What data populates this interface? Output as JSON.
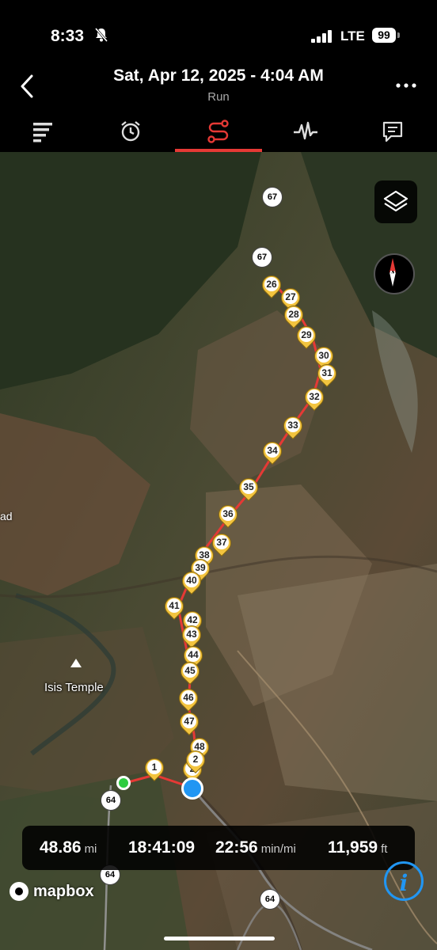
{
  "status_bar": {
    "time": "8:33",
    "network": "LTE",
    "battery": "99"
  },
  "header": {
    "title": "Sat, Apr 12, 2025 - 4:04 AM",
    "subtitle": "Run"
  },
  "tabs": [
    {
      "name": "summary-tab-icon"
    },
    {
      "name": "time-tab-icon"
    },
    {
      "name": "route-tab-icon",
      "active": true
    },
    {
      "name": "heart-rate-tab-icon"
    },
    {
      "name": "notes-tab-icon"
    }
  ],
  "map": {
    "poi_label": "Isis Temple",
    "edge_label": "ad",
    "route_shields": [
      "67",
      "67",
      "64",
      "64",
      "64"
    ],
    "mile_markers": [
      "1",
      "2",
      "26",
      "27",
      "28",
      "29",
      "30",
      "31",
      "32",
      "33",
      "34",
      "35",
      "36",
      "37",
      "38",
      "39",
      "40",
      "41",
      "42",
      "43",
      "44",
      "45",
      "46",
      "47",
      "48",
      "2"
    ],
    "compass_label": "N",
    "attribution": "mapbox",
    "accent_colors": {
      "route": "#e53935",
      "marker": "#f3c43f",
      "start": "#2ecc40",
      "current": "#2196f3"
    }
  },
  "stats": {
    "distance": {
      "value": "48.86",
      "unit": "mi"
    },
    "duration": {
      "value": "18:41:09"
    },
    "pace": {
      "value": "22:56",
      "unit": "min/mi"
    },
    "elevation": {
      "value": "11,959",
      "unit": "ft"
    }
  }
}
